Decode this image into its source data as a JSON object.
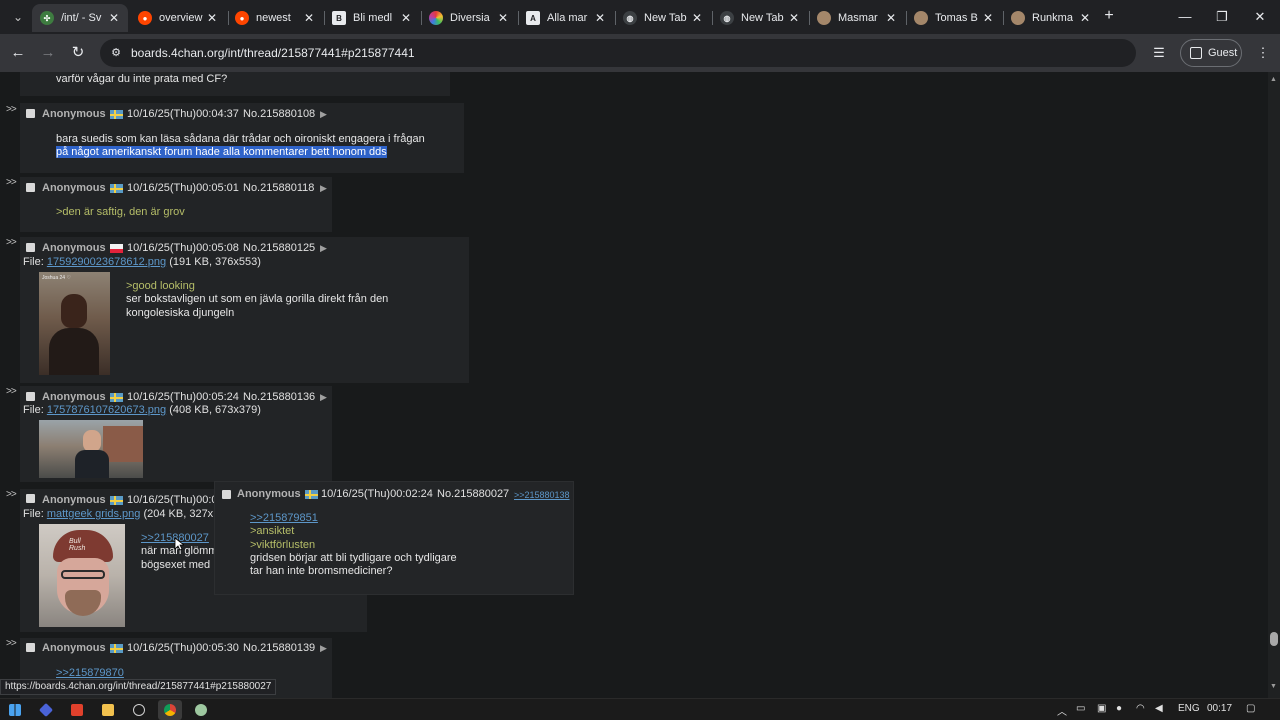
{
  "browser": {
    "tabs": [
      {
        "label": "/int/ - Sv",
        "active": true,
        "favicon": "4chan-icon",
        "color": "#3e7c40"
      },
      {
        "label": "overview",
        "active": false,
        "favicon": "reddit-icon",
        "color": "#ff4500"
      },
      {
        "label": "newest",
        "active": false,
        "favicon": "reddit-icon",
        "color": "#ff4500"
      },
      {
        "label": "Bli medl",
        "active": false,
        "favicon": "page-icon",
        "color": "#e8eaed"
      },
      {
        "label": "Diversia",
        "active": false,
        "favicon": "diversia-icon",
        "color": "#c23b9a"
      },
      {
        "label": "Alla mar",
        "active": false,
        "favicon": "page-icon",
        "color": "#e8eaed"
      },
      {
        "label": "New Tab",
        "active": false,
        "favicon": "globe-icon",
        "color": "#9aa0a6"
      },
      {
        "label": "New Tab",
        "active": false,
        "favicon": "globe-icon",
        "color": "#9aa0a6"
      },
      {
        "label": "Masmar",
        "active": false,
        "favicon": "avatar-icon",
        "color": "#a4876a"
      },
      {
        "label": "Tomas B",
        "active": false,
        "favicon": "avatar-icon",
        "color": "#a4876a"
      },
      {
        "label": "Runkma",
        "active": false,
        "favicon": "avatar-icon",
        "color": "#a4876a"
      }
    ],
    "url": "boards.4chan.org/int/thread/215877441#p215877441",
    "profile_label": "Guest"
  },
  "thread": {
    "top_text": "varför vågar du inte prata med CF?",
    "arrows": ">>",
    "file_prefix": "File:",
    "posts": [
      {
        "name": "Anonymous",
        "flag": "se",
        "datetime": "10/16/25(Thu)00:04:37",
        "number": "No.215880108",
        "lines": [
          "bara suedis som kan läsa sådana där trådar och oironiskt engagera i frågan"
        ],
        "selected_line": "på något amerikanskt forum hade alla kommentarer bett honom dds"
      },
      {
        "name": "Anonymous",
        "flag": "se",
        "datetime": "10/16/25(Thu)00:05:01",
        "number": "No.215880118",
        "greentext": [
          ">den är saftig, den är grov"
        ]
      },
      {
        "name": "Anonymous",
        "flag": "pl",
        "datetime": "10/16/25(Thu)00:05:08",
        "number": "No.215880125",
        "file_name": "1759290023678612.png",
        "file_info": "(191 KB, 376x553)",
        "thumb_caption": "Joshua 24 ♡",
        "greentext": [
          ">good looking"
        ],
        "lines": [
          "ser bokstavligen ut som en jävla gorilla direkt från den",
          "kongolesiska djungeln"
        ]
      },
      {
        "name": "Anonymous",
        "flag": "se",
        "datetime": "10/16/25(Thu)00:05:24",
        "number": "No.215880136",
        "file_name": "1757876107620673.png",
        "file_info": "(408 KB, 673x379)"
      },
      {
        "name": "Anonymous",
        "flag": "se",
        "datetime_partial": "10/16/25(Thu)00:0",
        "file_name": "mattgeek grids.png",
        "file_info": "(204 KB, 327x",
        "quote": ">>215880027",
        "lines": [
          "när man glömm",
          "bögsexet med"
        ],
        "thumb_logo": "Bull Rush"
      },
      {
        "name": "Anonymous",
        "flag": "se",
        "datetime": "10/16/25(Thu)00:05:30",
        "number": "No.215880139",
        "quote": ">>215879870"
      }
    ],
    "popup": {
      "name": "Anonymous",
      "flag": "se",
      "datetime": "10/16/25(Thu)00:02:24",
      "number": "No.215880027",
      "backlink": ">>215880138",
      "quote": ">>215879851",
      "greentext": [
        ">ansiktet",
        ">viktförlusten"
      ],
      "lines": [
        "gridsen börjar att bli tydligare och tydligare",
        "tar han inte bromsmediciner?"
      ]
    },
    "status_bar_url": "https://boards.4chan.org/int/thread/215877441#p215880027"
  },
  "taskbar": {
    "language": "ENG",
    "time": "00:17"
  }
}
